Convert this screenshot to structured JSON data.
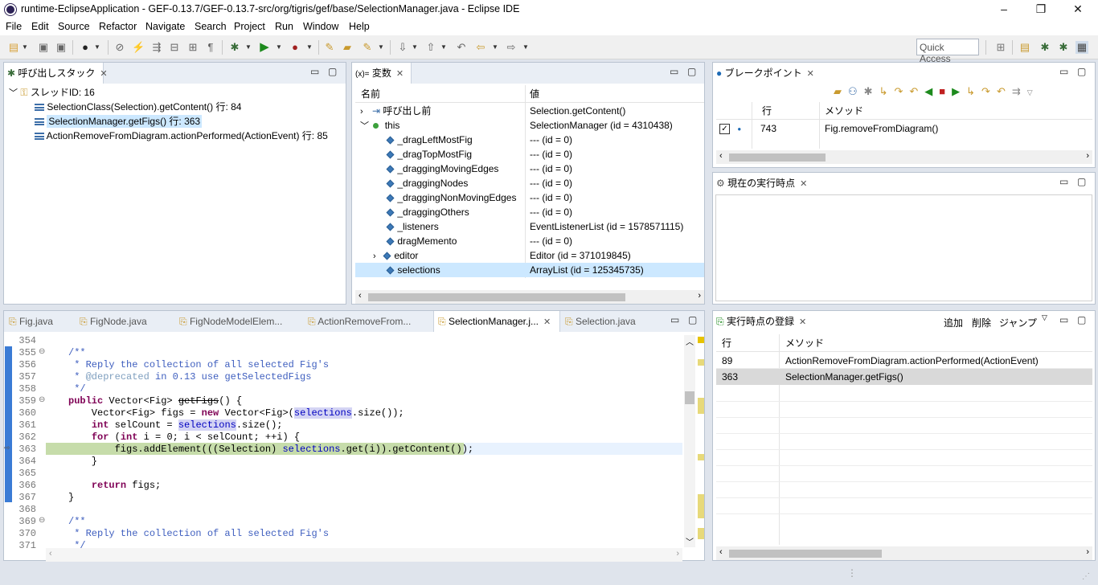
{
  "window": {
    "title": "runtime-EclipseApplication - GEF-0.13.7/GEF-0.13.7-src/org/tigris/gef/base/SelectionManager.java - Eclipse IDE",
    "minimize": "–",
    "restore": "❐",
    "close": "✕"
  },
  "menu": [
    "File",
    "Edit",
    "Source",
    "Refactor",
    "Navigate",
    "Search",
    "Project",
    "Run",
    "Window",
    "Help"
  ],
  "quick_access": "Quick Access",
  "callstack": {
    "tab": "呼び出しスタック",
    "thread": "スレッドID: 16",
    "frames": [
      "SelectionClass(Selection).getContent() 行: 84",
      "SelectionManager.getFigs() 行: 363",
      "ActionRemoveFromDiagram.actionPerformed(ActionEvent) 行: 85"
    ]
  },
  "variables": {
    "tab": "変数",
    "tab_prefix": "(x)=",
    "col_name": "名前",
    "col_value": "値",
    "rows": [
      {
        "name": "呼び出し前",
        "value": "Selection.getContent()"
      },
      {
        "name": "this",
        "value": "SelectionManager (id = 4310438)"
      },
      {
        "name": "_dragLeftMostFig",
        "value": "--- (id = 0)"
      },
      {
        "name": "_dragTopMostFig",
        "value": "--- (id = 0)"
      },
      {
        "name": "_draggingMovingEdges",
        "value": "--- (id = 0)"
      },
      {
        "name": "_draggingNodes",
        "value": "--- (id = 0)"
      },
      {
        "name": "_draggingNonMovingEdges",
        "value": "--- (id = 0)"
      },
      {
        "name": "_draggingOthers",
        "value": "--- (id = 0)"
      },
      {
        "name": "_listeners",
        "value": "EventListenerList (id = 1578571115)"
      },
      {
        "name": "dragMemento",
        "value": "--- (id = 0)"
      },
      {
        "name": "editor",
        "value": "Editor (id = 371019845)"
      },
      {
        "name": "selections",
        "value": "ArrayList (id = 125345735)"
      }
    ]
  },
  "breakpoints": {
    "tab": "ブレークポイント",
    "col_line": "行",
    "col_method": "メソッド",
    "rows": [
      {
        "line": "743",
        "method": "Fig.removeFromDiagram()"
      }
    ]
  },
  "current_point": {
    "tab": "現在の実行時点"
  },
  "editor": {
    "tabs": [
      "Fig.java",
      "FigNode.java",
      "FigNodeModelElem...",
      "ActionRemoveFrom...",
      "SelectionManager.j...",
      "Selection.java"
    ],
    "line_numbers": [
      "354",
      "355",
      "356",
      "357",
      "358",
      "359",
      "360",
      "361",
      "362",
      "363",
      "364",
      "365",
      "366",
      "367",
      "368",
      "369",
      "370",
      "371"
    ]
  },
  "registered": {
    "tab": "実行時点の登録",
    "add": "追加",
    "delete": "削除",
    "jump": "ジャンプ",
    "col_line": "行",
    "col_method": "メソッド",
    "rows": [
      {
        "line": "89",
        "method": "ActionRemoveFromDiagram.actionPerformed(ActionEvent)"
      },
      {
        "line": "363",
        "method": "SelectionManager.getFigs()"
      }
    ]
  }
}
